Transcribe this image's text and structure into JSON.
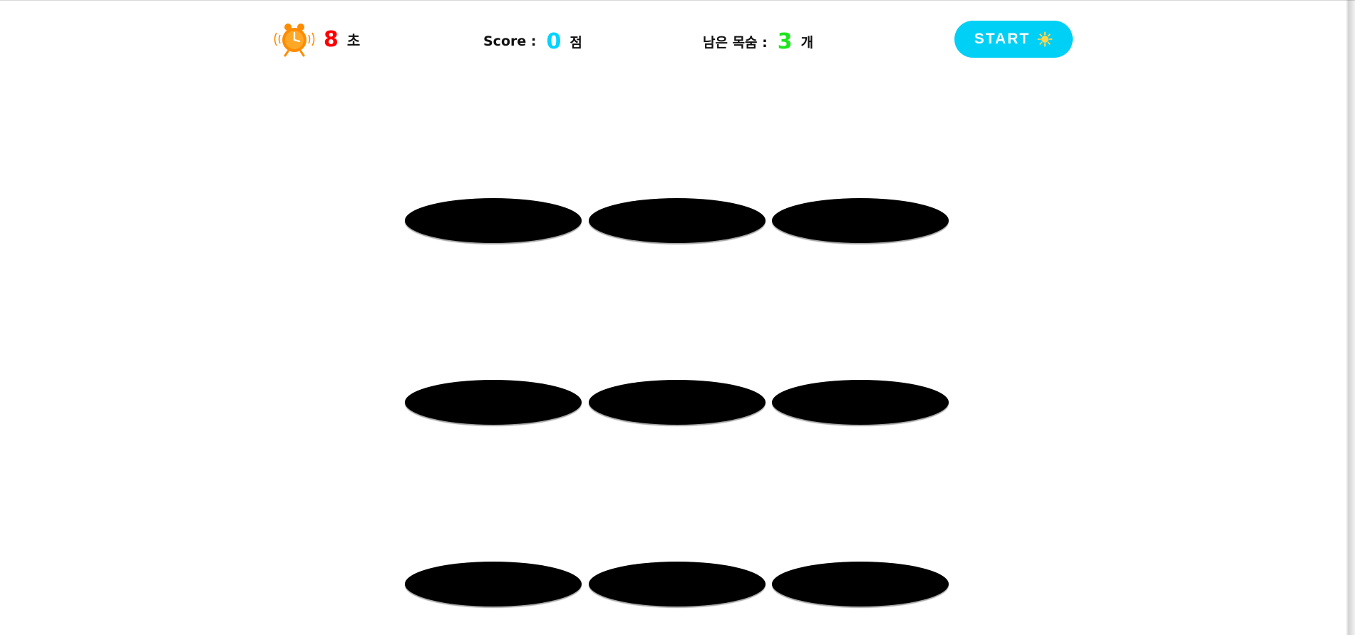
{
  "hud": {
    "timer": {
      "icon": "alarm-clock-icon",
      "value": "8",
      "unit": "초"
    },
    "score": {
      "label": "Score :",
      "value": "0",
      "unit": "점"
    },
    "lives": {
      "label": "남은 목숨 :",
      "value": "3",
      "unit": "개"
    }
  },
  "start_button": {
    "label": "START",
    "icon": "sun-icon"
  },
  "board": {
    "rows": 3,
    "cols": 3,
    "holes": [
      "hole",
      "hole",
      "hole",
      "hole",
      "hole",
      "hole",
      "hole",
      "hole",
      "hole"
    ]
  },
  "colors": {
    "timer_value": "#ff0000",
    "score_value": "#00d4ff",
    "lives_value": "#1de51d",
    "start_button": "#00d0f5",
    "hole": "#000000",
    "clock": "#ff8c00"
  }
}
